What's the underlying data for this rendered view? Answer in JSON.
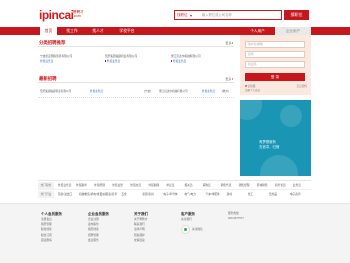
{
  "header": {
    "logo_main": "ipincai",
    "logo_sub_line1": "聘聘才",
    "logo_sub_line2": ".com",
    "search_category": "找职位",
    "search_placeholder": "输入职位或公司名称",
    "search_button": "搜职位"
  },
  "nav": {
    "items": [
      {
        "label": "首页",
        "active": true
      },
      {
        "label": "找工作",
        "active": false
      },
      {
        "label": "找人才",
        "active": false
      },
      {
        "label": "学校平台",
        "active": false
      }
    ]
  },
  "featured": {
    "title": "分类招聘推荐",
    "more": "更多",
    "cards": [
      {
        "company": "宁波凯诺国际贸易有限公司",
        "tag": "外贸业务员"
      },
      {
        "company": "佰乐集团福建鞋业有限公司",
        "tag": "外贸业务员"
      },
      {
        "company": "浙江贝达尔机械有限公司",
        "tag": "外贸业务员"
      }
    ]
  },
  "recent": {
    "title": "最新招聘",
    "more": "更多",
    "items": [
      {
        "text": "佰乐集团福建鞋业有限公司",
        "blue": false
      },
      {
        "text": "外贸业务员",
        "blue": true
      },
      {
        "text": "[宁波]",
        "blue": false
      },
      {
        "text": "浙江贝达尔机械有限公司",
        "blue": false
      },
      {
        "text": "外贸业务员",
        "blue": true
      },
      {
        "text": "[杭州]",
        "blue": false
      }
    ]
  },
  "login": {
    "tab_personal": "个人用户",
    "tab_company": "企业用户",
    "username_placeholder": "用户名/邮箱",
    "password_placeholder": "密码",
    "code_placeholder": "验证码",
    "remember": "记住我",
    "forgot": "忘记密码",
    "login_button": "登 录",
    "register": "注册个人会员"
  },
  "banner": {
    "line1": "有梦想就有",
    "line2": "去追寻，归宿"
  },
  "categories": {
    "rows": [
      {
        "label": "热门职位",
        "items": [
          "外贸业务员",
          "外贸跟单",
          "外贸经理",
          "外贸主管",
          "外贸文员",
          "外贸助理",
          "单证员",
          "报关员",
          "采购员",
          "销售代表",
          "销售经理",
          "区域销售",
          "商务专员",
          "业务员"
        ]
      },
      {
        "label": "热门行业",
        "items": [
          "贸易/进出口",
          "机械制造/机电/重工",
          "纺织服装/皮革",
          "五金",
          "家居/家具",
          "电子/半导体",
          "电气/电力",
          "汽车/零配件",
          "建材",
          "化工",
          "日用品",
          "电子商务"
        ]
      }
    ]
  },
  "footer": {
    "columns": [
      {
        "title": "个人会员服务",
        "links": [
          "注册会员",
          "简历管理",
          "职位搜索",
          "职位订阅",
          "面试邀请"
        ]
      },
      {
        "title": "企业会员服务",
        "links": [
          "企业注册",
          "发布职位",
          "简历搜索",
          "招聘管理",
          "会员服务"
        ]
      },
      {
        "title": "关于我们",
        "links": [
          "关于聘聘才",
          "联系我们",
          "法律声明",
          "隐私保护",
          "友情链接"
        ]
      },
      {
        "title": "客户服务",
        "links": [
          "关注我们",
          "",
          ""
        ]
      },
      {
        "title": "",
        "links": [
          "服务热线",
          "400-6677577"
        ]
      }
    ],
    "wx_label": "关注微信"
  },
  "colors": {
    "brand_red": "#c8161d",
    "link_blue": "#3366cc",
    "login_bg": "#fbe8df",
    "banner_teal": "#1a96b4"
  }
}
